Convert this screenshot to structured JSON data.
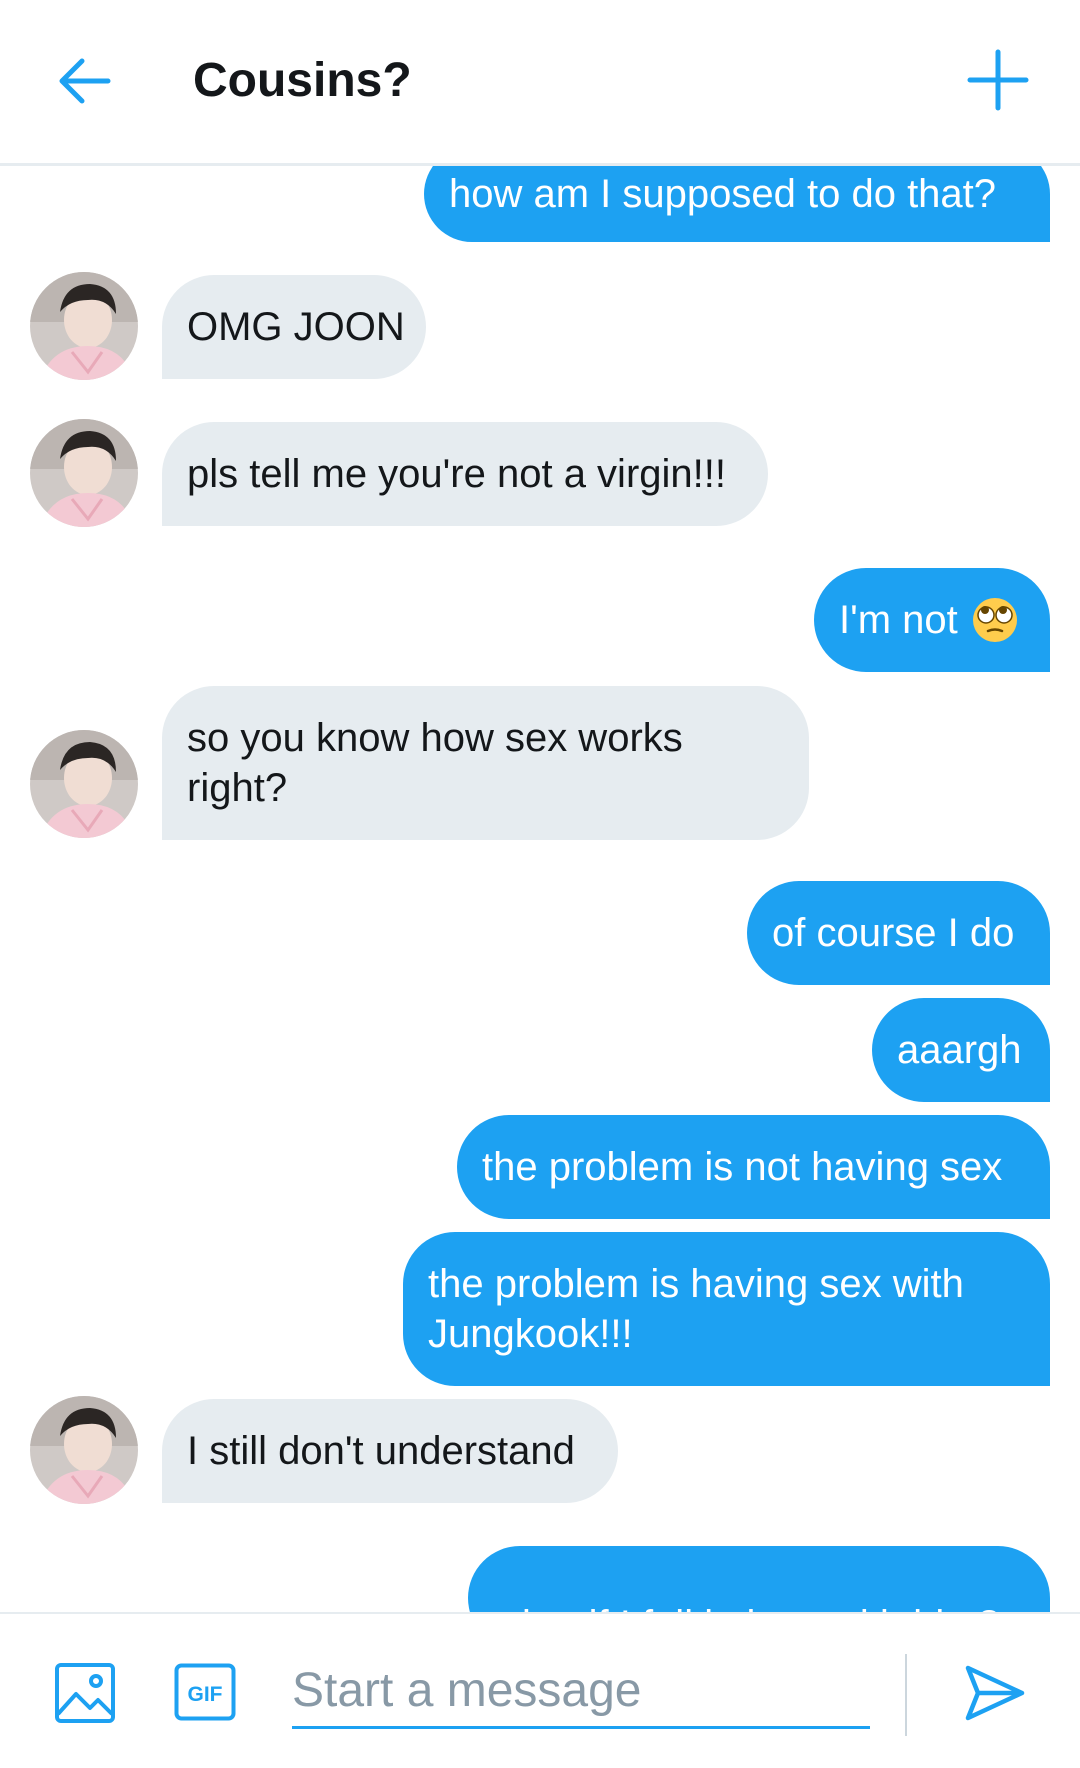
{
  "header": {
    "title": "Cousins?",
    "back_icon": "arrow-left-icon",
    "add_icon": "plus-icon"
  },
  "messages": [
    {
      "from": "me",
      "text": "how am I supposed to do that?"
    },
    {
      "from": "cousin",
      "text": "OMG JOON"
    },
    {
      "from": "cousin",
      "text": "pls tell me you're not a virgin!!!"
    },
    {
      "from": "me",
      "text": "I'm not",
      "emoji": "face-with-rolling-eyes"
    },
    {
      "from": "cousin",
      "text": "so you know how sex works right?"
    },
    {
      "from": "me",
      "text": "of course I do"
    },
    {
      "from": "me",
      "text": "aaargh"
    },
    {
      "from": "me",
      "text": "the problem is not having sex"
    },
    {
      "from": "me",
      "text": "the problem is having sex with Jungkook!!!"
    },
    {
      "from": "cousin",
      "text": "I still don't understand"
    },
    {
      "from": "me",
      "text": "what if I fall in love with him?"
    }
  ],
  "composer": {
    "placeholder": "Start a message",
    "value": "",
    "gif_label": "GIF",
    "image_icon": "image-icon",
    "send_icon": "send-icon"
  },
  "colors": {
    "accent": "#1da1f2",
    "received_bubble": "#e6ecf0",
    "text": "#14171a"
  }
}
